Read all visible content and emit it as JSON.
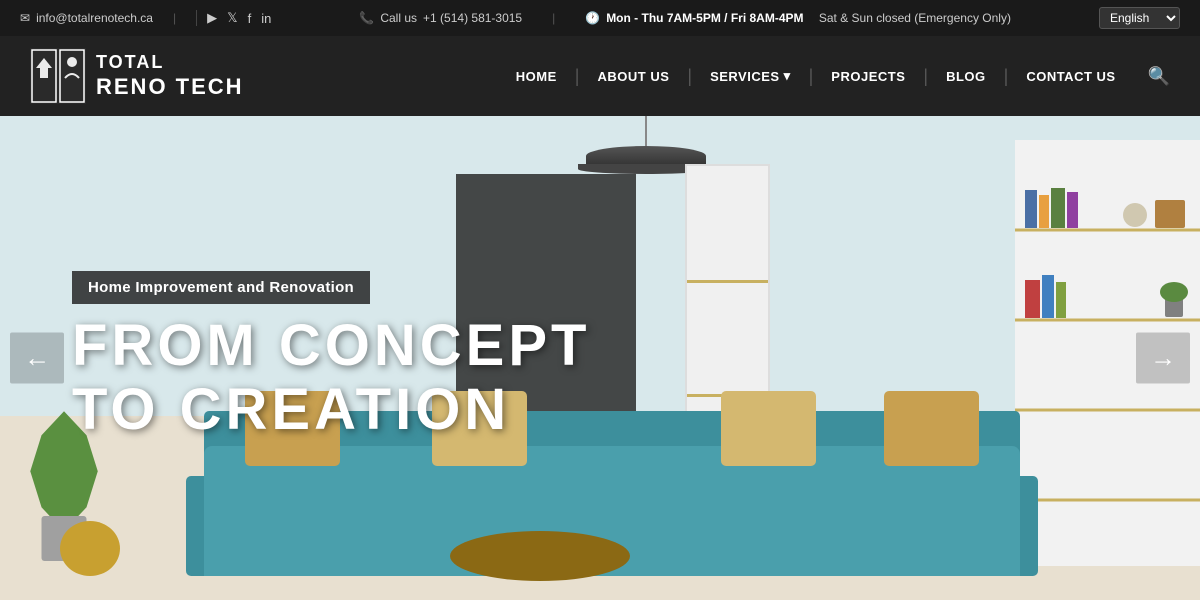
{
  "topbar": {
    "email": "info@totalrenotech.ca",
    "phone_label": "Call us",
    "phone_number": "+1 (514) 581-3015",
    "hours_label": "Mon - Thu 7AM-5PM / Fri 8AM-4PM",
    "hours_suffix": "Sat & Sun closed (Emergency Only)",
    "language": "English"
  },
  "navbar": {
    "logo_line1": "TOTAL",
    "logo_line2": "RENO TECH",
    "nav_items": [
      {
        "label": "HOME",
        "has_dropdown": false
      },
      {
        "label": "ABOUT US",
        "has_dropdown": false
      },
      {
        "label": "SERVICES",
        "has_dropdown": true
      },
      {
        "label": "PROJECTS",
        "has_dropdown": false
      },
      {
        "label": "BLOG",
        "has_dropdown": false
      },
      {
        "label": "CONTACT US",
        "has_dropdown": false
      }
    ]
  },
  "hero": {
    "subtitle": "Home Improvement and Renovation",
    "title_line1": "FROM CONCEPT",
    "title_line2": "TO CREATION"
  },
  "arrows": {
    "left": "←",
    "right": "→"
  }
}
